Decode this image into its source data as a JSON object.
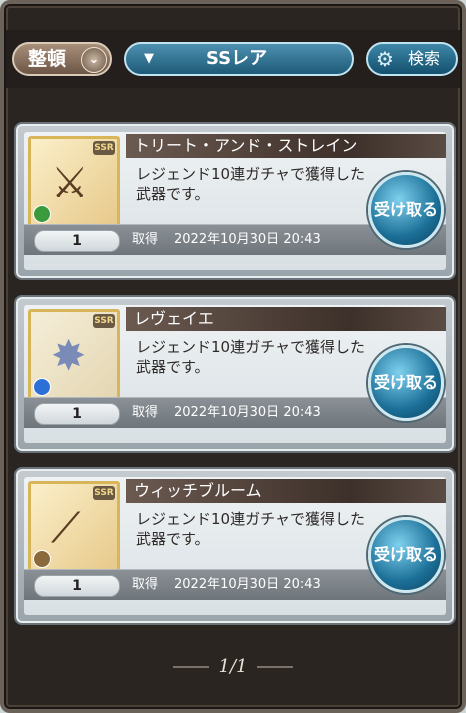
{
  "toolbar": {
    "sort_label": "整頓",
    "filter_selected": "SSレア",
    "search_label": "検索"
  },
  "items": [
    {
      "name": "トリート・アンド・ストレイン",
      "description": "レジェンド10連ガチャで獲得した武器です。",
      "quantity": "1",
      "acquired_label": "取得",
      "acquired_date": "2022年10月30日 20:43",
      "receive_label": "受け取る",
      "rarity": "SSR",
      "element_color": "#3b9b3c",
      "icon": "scythe-icon"
    },
    {
      "name": "レヴェイエ",
      "description": "レジェンド10連ガチャで獲得した武器です。",
      "quantity": "1",
      "acquired_label": "取得",
      "acquired_date": "2022年10月30日 20:43",
      "receive_label": "受け取る",
      "rarity": "SSR",
      "element_color": "#2c6fd6",
      "icon": "winged-spear-icon"
    },
    {
      "name": "ウィッチブルーム",
      "description": "レジェンド10連ガチャで獲得した武器です。",
      "quantity": "1",
      "acquired_label": "取得",
      "acquired_date": "2022年10月30日 20:43",
      "receive_label": "受け取る",
      "rarity": "SSR",
      "element_color": "#8a6a3a",
      "icon": "broom-icon"
    }
  ],
  "pagination": {
    "label": "1/1"
  }
}
